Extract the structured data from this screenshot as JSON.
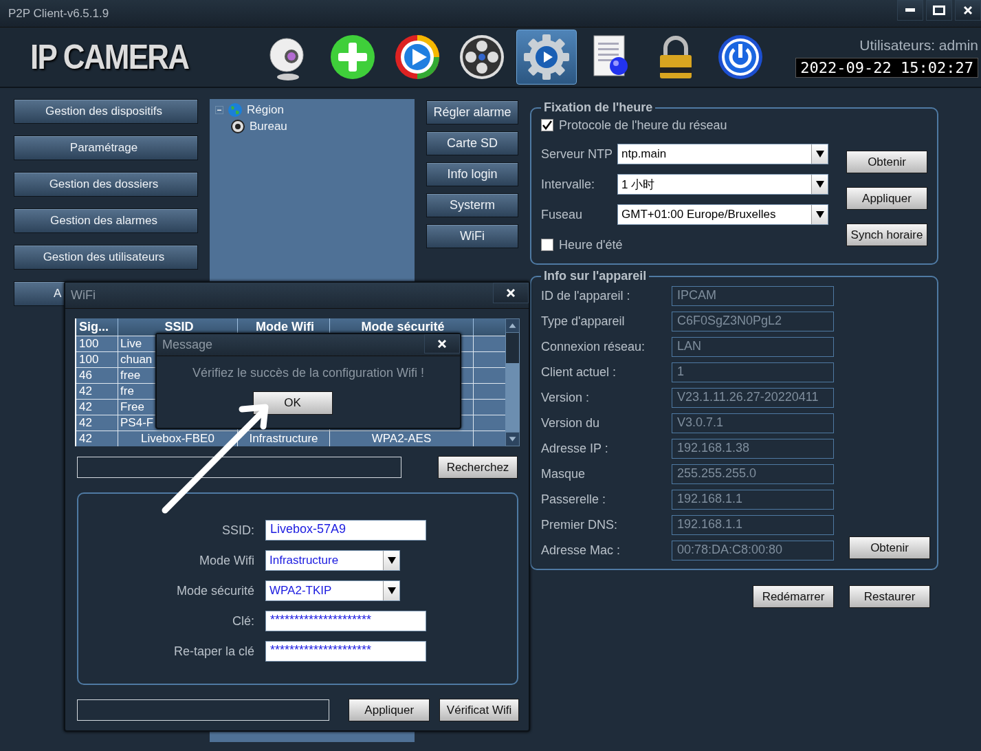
{
  "window": {
    "title": "P2P Client-v6.5.1.9"
  },
  "header": {
    "logo": "IP CAMERA",
    "user": "Utilisateurs: admin",
    "datetime": "2022-09-22 15:02:27",
    "toolbar": [
      {
        "kind": "webcam",
        "selected": false
      },
      {
        "kind": "add",
        "selected": false
      },
      {
        "kind": "play",
        "selected": false
      },
      {
        "kind": "reel",
        "selected": false
      },
      {
        "kind": "settings",
        "selected": true
      },
      {
        "kind": "document",
        "selected": false
      },
      {
        "kind": "lock",
        "selected": false
      },
      {
        "kind": "power",
        "selected": false
      }
    ]
  },
  "nav_buttons": [
    "Gestion des dispositifs",
    "Paramétrage",
    "Gestion des dossiers",
    "Gestion des alarmes",
    "Gestion des utilisateurs",
    "A"
  ],
  "tree": [
    {
      "label": "Région",
      "expanded": true,
      "children": [
        {
          "label": "Bureau"
        }
      ]
    }
  ],
  "settings_buttons": [
    "Régler alarme",
    "Carte SD",
    "Info login",
    "Systerm",
    "WiFi"
  ],
  "time_settings": {
    "title": "Fixation de l'heure",
    "ntp": {
      "label": "Protocole de l'heure du réseau",
      "checked": true
    },
    "fields": [
      {
        "label": "Serveur NTP",
        "value": "ntp.main"
      },
      {
        "label": "Intervalle:",
        "value": "1 小时"
      },
      {
        "label": "Fuseau",
        "value": "GMT+01:00 Europe/Bruxelles"
      }
    ],
    "dst": {
      "label": "Heure d'été",
      "checked": false
    },
    "buttons": [
      "Obtenir",
      "Appliquer",
      "Synch horaire"
    ]
  },
  "device_info": {
    "title": "Info sur l'appareil",
    "button": "Obtenir",
    "rows": [
      {
        "label": "ID de l'appareil :",
        "value": "IPCAM"
      },
      {
        "label": "Type d'appareil",
        "value": "C6F0SgZ3N0PgL2"
      },
      {
        "label": "Connexion réseau:",
        "value": "LAN"
      },
      {
        "label": "Client actuel :",
        "value": "1"
      },
      {
        "label": "Version :",
        "value": "V23.1.11.26.27-20220411"
      },
      {
        "label": "Version du",
        "value": "V3.0.7.1"
      },
      {
        "label": "Adresse IP :",
        "value": "192.168.1.38"
      },
      {
        "label": "Masque",
        "value": "255.255.255.0"
      },
      {
        "label": "Passerelle :",
        "value": "192.168.1.1"
      },
      {
        "label": "Premier DNS:",
        "value": "192.168.1.1"
      },
      {
        "label": "Adresse Mac :",
        "value": "00:78:DA:C8:00:80"
      }
    ]
  },
  "footer_buttons": [
    "Redémarrer",
    "Restaurer"
  ],
  "wifi_dialog": {
    "title": "WiFi",
    "columns": [
      "Sig...",
      "SSID",
      "Mode Wifi",
      "Mode sécurité"
    ],
    "rows": [
      {
        "signal": "100",
        "ssid": "Live"
      },
      {
        "signal": "100",
        "ssid": "chuan"
      },
      {
        "signal": "46",
        "ssid": "free"
      },
      {
        "signal": "42",
        "ssid": "fre"
      },
      {
        "signal": "42",
        "ssid": "Free"
      },
      {
        "signal": "42",
        "ssid": "PS4-F"
      },
      {
        "signal": "42",
        "ssid": "Livebox-FBE0",
        "mode": "Infrastructure",
        "security": "WPA2-AES"
      }
    ],
    "search_button": "Recherchez",
    "form": [
      {
        "label": "SSID:",
        "kind": "text",
        "value": "Livebox-57A9"
      },
      {
        "label": "Mode Wifi",
        "kind": "select",
        "value": "Infrastructure"
      },
      {
        "label": "Mode sécurité",
        "kind": "select",
        "value": "WPA2-TKIP"
      },
      {
        "label": "Clé:",
        "kind": "text",
        "value": "*********************"
      },
      {
        "label": "Re-taper la clé",
        "kind": "text",
        "value": "*********************"
      }
    ],
    "buttons": [
      "Appliquer",
      "Vérificat Wifi"
    ]
  },
  "message_dialog": {
    "title": "Message",
    "text": "Vérifiez le succès de la configuration Wifi !",
    "button": "OK"
  }
}
